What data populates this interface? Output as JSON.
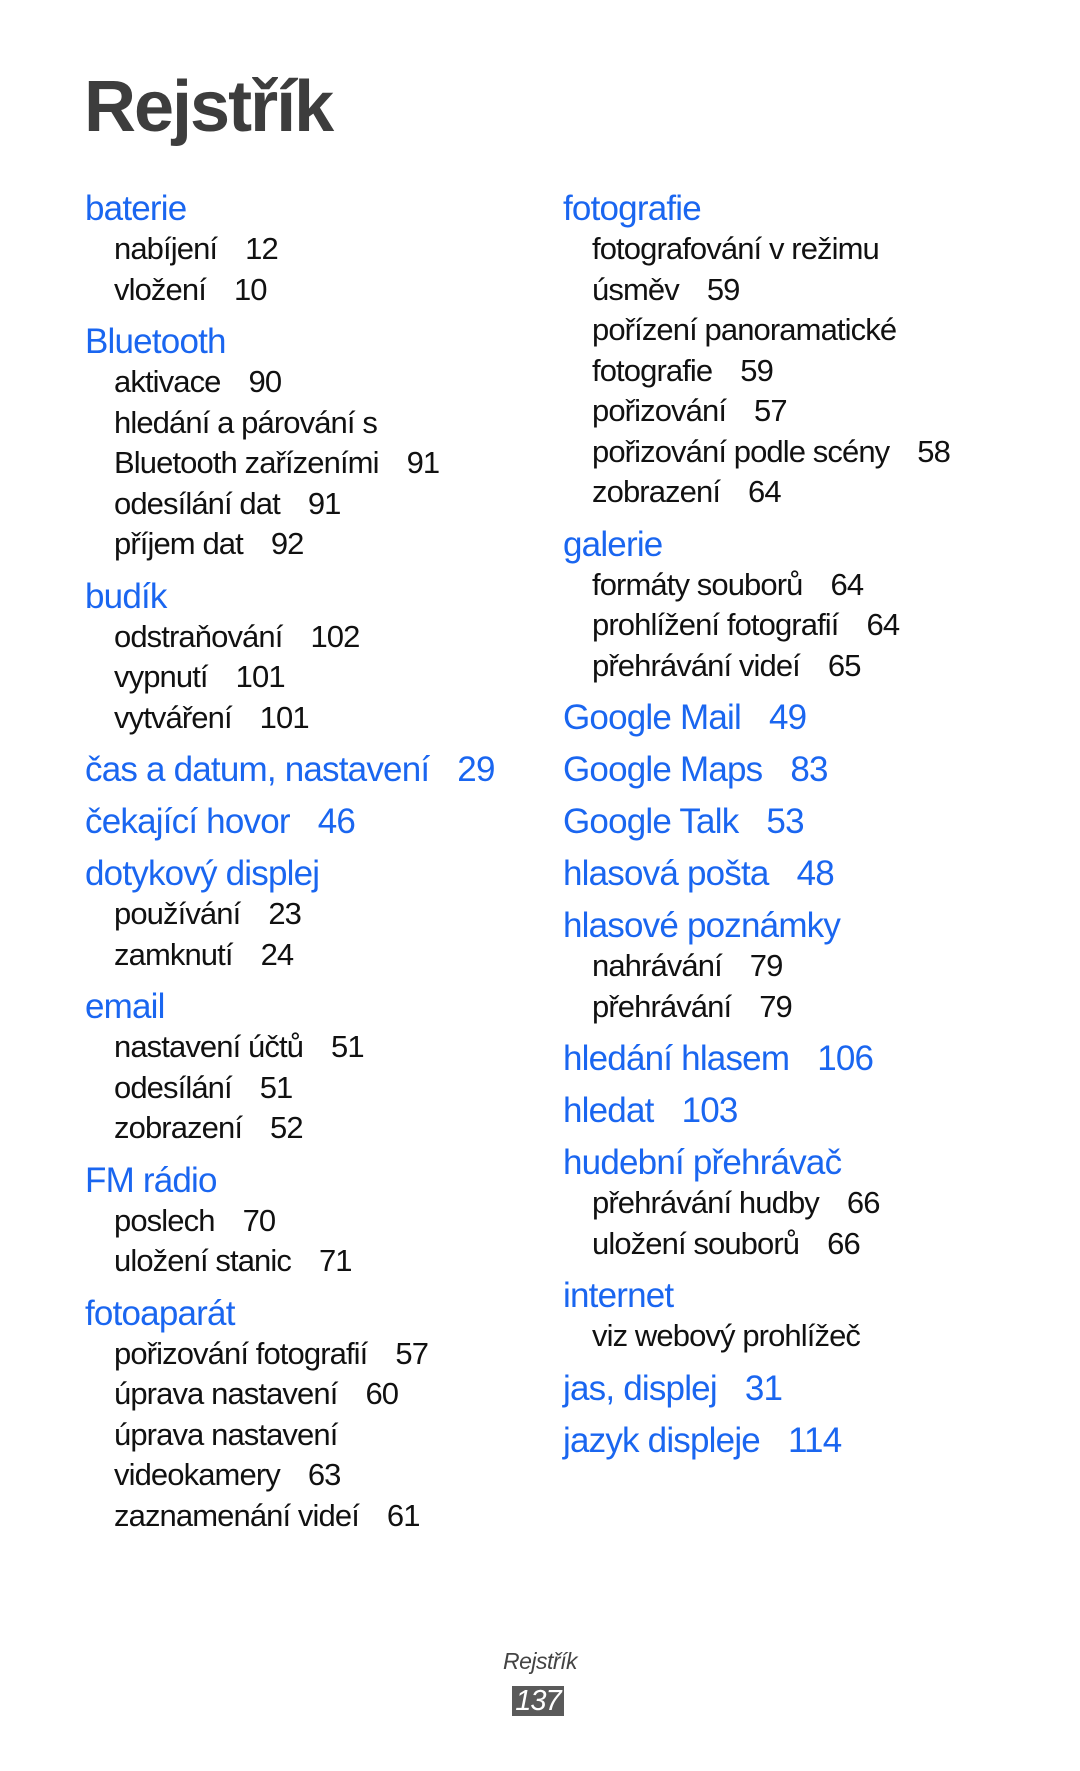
{
  "title": "Rejstřík",
  "colors": {
    "heading": "#1a66f0",
    "text": "#111111",
    "title": "#3d3d3d"
  },
  "columns": [
    [
      {
        "term": "baterie",
        "subs": [
          {
            "lines": [
              "nabíjení"
            ],
            "page": "12"
          },
          {
            "lines": [
              "vložení"
            ],
            "page": "10"
          }
        ]
      },
      {
        "term": "Bluetooth",
        "subs": [
          {
            "lines": [
              "aktivace"
            ],
            "page": "90"
          },
          {
            "lines": [
              "hledání a párování s",
              "Bluetooth zařízeními"
            ],
            "page": "91"
          },
          {
            "lines": [
              "odesílání dat"
            ],
            "page": "91"
          },
          {
            "lines": [
              "příjem dat"
            ],
            "page": "92"
          }
        ]
      },
      {
        "term": "budík",
        "subs": [
          {
            "lines": [
              "odstraňování"
            ],
            "page": "102"
          },
          {
            "lines": [
              "vypnutí"
            ],
            "page": "101"
          },
          {
            "lines": [
              "vytváření"
            ],
            "page": "101"
          }
        ]
      },
      {
        "term": "čas a datum, nastavení",
        "page": "29"
      },
      {
        "term": "čekající hovor",
        "page": "46"
      },
      {
        "term": "dotykový displej",
        "subs": [
          {
            "lines": [
              "používání"
            ],
            "page": "23"
          },
          {
            "lines": [
              "zamknutí"
            ],
            "page": "24"
          }
        ]
      },
      {
        "term": "email",
        "subs": [
          {
            "lines": [
              "nastavení účtů"
            ],
            "page": "51"
          },
          {
            "lines": [
              "odesílání"
            ],
            "page": "51"
          },
          {
            "lines": [
              "zobrazení"
            ],
            "page": "52"
          }
        ]
      },
      {
        "term": "FM rádio",
        "subs": [
          {
            "lines": [
              "poslech"
            ],
            "page": "70"
          },
          {
            "lines": [
              "uložení stanic"
            ],
            "page": "71"
          }
        ]
      },
      {
        "term": "fotoaparát",
        "subs": [
          {
            "lines": [
              "pořizování fotografií"
            ],
            "page": "57"
          },
          {
            "lines": [
              "úprava nastavení"
            ],
            "page": "60"
          },
          {
            "lines": [
              "úprava nastavení",
              "videokamery"
            ],
            "page": "63"
          },
          {
            "lines": [
              "zaznamenání videí"
            ],
            "page": "61"
          }
        ]
      }
    ],
    [
      {
        "term": "fotografie",
        "subs": [
          {
            "lines": [
              "fotografování v režimu",
              "úsměv"
            ],
            "page": "59"
          },
          {
            "lines": [
              "pořízení panoramatické",
              "fotografie"
            ],
            "page": "59"
          },
          {
            "lines": [
              "pořizování"
            ],
            "page": "57"
          },
          {
            "lines": [
              "pořizování podle scény"
            ],
            "page": "58"
          },
          {
            "lines": [
              "zobrazení"
            ],
            "page": "64"
          }
        ]
      },
      {
        "term": "galerie",
        "subs": [
          {
            "lines": [
              "formáty souborů"
            ],
            "page": "64"
          },
          {
            "lines": [
              "prohlížení fotografií"
            ],
            "page": "64"
          },
          {
            "lines": [
              "přehrávání videí"
            ],
            "page": "65"
          }
        ]
      },
      {
        "term": "Google Mail",
        "page": "49"
      },
      {
        "term": "Google Maps",
        "page": "83"
      },
      {
        "term": "Google Talk",
        "page": "53"
      },
      {
        "term": "hlasová pošta",
        "page": "48"
      },
      {
        "term": "hlasové poznámky",
        "subs": [
          {
            "lines": [
              "nahrávání"
            ],
            "page": "79"
          },
          {
            "lines": [
              "přehrávání"
            ],
            "page": "79"
          }
        ]
      },
      {
        "term": "hledání hlasem",
        "page": "106"
      },
      {
        "term": "hledat",
        "page": "103"
      },
      {
        "term": "hudební přehrávač",
        "subs": [
          {
            "lines": [
              "přehrávání hudby"
            ],
            "page": "66"
          },
          {
            "lines": [
              "uložení souborů"
            ],
            "page": "66"
          }
        ]
      },
      {
        "term": "internet",
        "subs": [
          {
            "lines": [
              "viz webový prohlížeč"
            ]
          }
        ]
      },
      {
        "term": "jas, displej",
        "page": "31"
      },
      {
        "term": "jazyk displeje",
        "page": "114"
      }
    ]
  ],
  "footer": {
    "label": "Rejstřík",
    "page": "137"
  }
}
